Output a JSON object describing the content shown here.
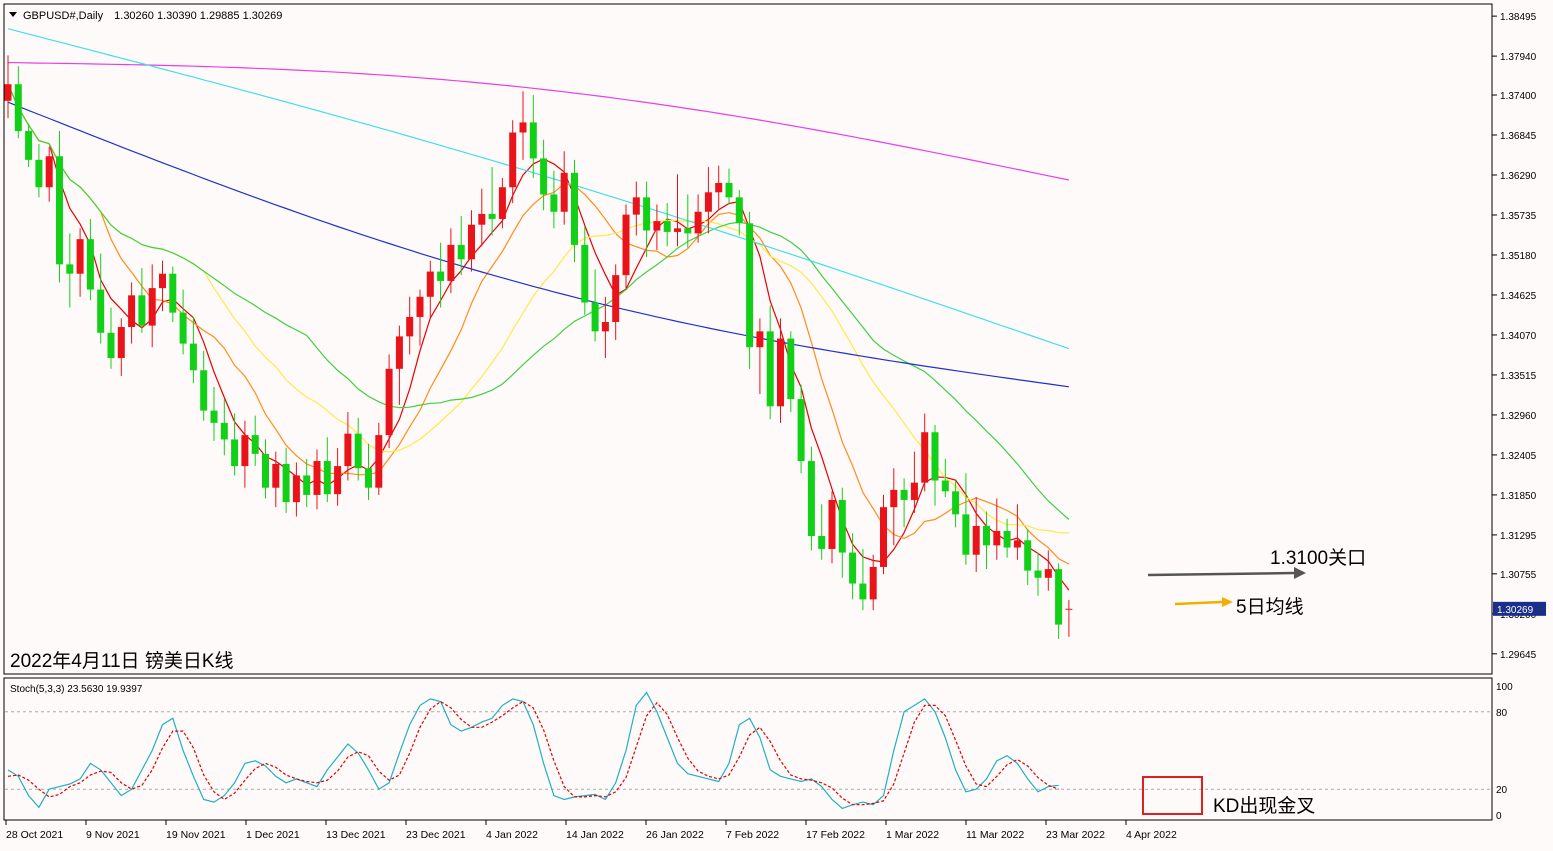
{
  "chart_data": {
    "type": "candlestick",
    "symbol_header": "GBPUSD#,Daily",
    "ohlc_header": "1.30260 1.30390 1.29885 1.30269",
    "annotation_title": "2022年4月11日 镑美日K线",
    "current_price_label": "1.30269",
    "price_axis": {
      "ticks": [
        "1.38495",
        "1.37940",
        "1.37400",
        "1.36845",
        "1.36290",
        "1.35735",
        "1.35180",
        "1.34625",
        "1.34070",
        "1.33515",
        "1.32960",
        "1.32405",
        "1.31850",
        "1.31295",
        "1.30755",
        "1.30200",
        "1.29645"
      ],
      "range": [
        1.2942,
        1.3858
      ]
    },
    "date_ticks": [
      "28 Oct 2021",
      "9 Nov 2021",
      "19 Nov 2021",
      "1 Dec 2021",
      "13 Dec 2021",
      "23 Dec 2021",
      "4 Jan 2022",
      "14 Jan 2022",
      "26 Jan 2022",
      "7 Feb 2022",
      "17 Feb 2022",
      "1 Mar 2022",
      "11 Mar 2022",
      "23 Mar 2022",
      "4 Apr 2022"
    ],
    "callouts": {
      "level_1310": "1.3100关口",
      "ma5": "5日均线",
      "kd_cross": "KD出现金叉"
    },
    "colors": {
      "bull": "#e8141a",
      "bear": "#12d018",
      "ma5": "#e60000",
      "ma10": "#ff8c1a",
      "ma20": "#ffe84a",
      "ma30": "#40d040",
      "ma60": "#2030d0",
      "ma120": "#40e0e8",
      "ma250": "#e640e6",
      "stoch_main": "#20b0c0",
      "stoch_signal": "#e00000"
    },
    "candles": [
      [
        1.3732,
        1.3795,
        1.3708,
        1.3755
      ],
      [
        1.3755,
        1.378,
        1.368,
        1.369
      ],
      [
        1.369,
        1.37,
        1.364,
        1.365
      ],
      [
        1.365,
        1.3672,
        1.3598,
        1.3612
      ],
      [
        1.3612,
        1.3668,
        1.3592,
        1.3655
      ],
      [
        1.3655,
        1.369,
        1.348,
        1.3505
      ],
      [
        1.3505,
        1.3548,
        1.3445,
        1.3492
      ],
      [
        1.3492,
        1.3555,
        1.346,
        1.354
      ],
      [
        1.354,
        1.3568,
        1.3455,
        1.347
      ],
      [
        1.347,
        1.352,
        1.3395,
        1.341
      ],
      [
        1.341,
        1.3445,
        1.336,
        1.3375
      ],
      [
        1.3375,
        1.343,
        1.335,
        1.3418
      ],
      [
        1.3418,
        1.348,
        1.3395,
        1.3462
      ],
      [
        1.3462,
        1.35,
        1.341,
        1.342
      ],
      [
        1.342,
        1.3505,
        1.339,
        1.3472
      ],
      [
        1.3472,
        1.351,
        1.344,
        1.3492
      ],
      [
        1.3492,
        1.3502,
        1.3425,
        1.3438
      ],
      [
        1.3438,
        1.347,
        1.338,
        1.3395
      ],
      [
        1.3395,
        1.3432,
        1.334,
        1.3358
      ],
      [
        1.3358,
        1.3385,
        1.3288,
        1.3302
      ],
      [
        1.3302,
        1.3335,
        1.326,
        1.3285
      ],
      [
        1.3285,
        1.3318,
        1.324,
        1.3262
      ],
      [
        1.3262,
        1.3298,
        1.3212,
        1.3225
      ],
      [
        1.3225,
        1.3288,
        1.3195,
        1.3268
      ],
      [
        1.3268,
        1.3295,
        1.3225,
        1.3242
      ],
      [
        1.3242,
        1.3262,
        1.318,
        1.3195
      ],
      [
        1.3195,
        1.3245,
        1.3168,
        1.3228
      ],
      [
        1.3228,
        1.325,
        1.316,
        1.3175
      ],
      [
        1.3175,
        1.323,
        1.3155,
        1.3212
      ],
      [
        1.3212,
        1.3235,
        1.3168,
        1.3185
      ],
      [
        1.3185,
        1.3248,
        1.3165,
        1.3232
      ],
      [
        1.3232,
        1.3265,
        1.3175,
        1.3186
      ],
      [
        1.3186,
        1.325,
        1.317,
        1.3225
      ],
      [
        1.3225,
        1.33,
        1.3205,
        1.327
      ],
      [
        1.327,
        1.3292,
        1.3205,
        1.3222
      ],
      [
        1.3222,
        1.3256,
        1.3178,
        1.3195
      ],
      [
        1.3195,
        1.3285,
        1.3185,
        1.3268
      ],
      [
        1.3268,
        1.338,
        1.325,
        1.336
      ],
      [
        1.336,
        1.342,
        1.331,
        1.3405
      ],
      [
        1.3405,
        1.346,
        1.338,
        1.3432
      ],
      [
        1.3432,
        1.347,
        1.3392,
        1.346
      ],
      [
        1.346,
        1.351,
        1.343,
        1.3495
      ],
      [
        1.3495,
        1.3535,
        1.3445,
        1.3482
      ],
      [
        1.3482,
        1.3555,
        1.3465,
        1.3532
      ],
      [
        1.3532,
        1.3572,
        1.349,
        1.3512
      ],
      [
        1.3512,
        1.358,
        1.3495,
        1.356
      ],
      [
        1.356,
        1.361,
        1.353,
        1.3575
      ],
      [
        1.3575,
        1.364,
        1.3545,
        1.3568
      ],
      [
        1.3568,
        1.3625,
        1.3555,
        1.3612
      ],
      [
        1.3612,
        1.3705,
        1.359,
        1.3688
      ],
      [
        1.3688,
        1.3745,
        1.365,
        1.3702
      ],
      [
        1.3702,
        1.374,
        1.3625,
        1.3652
      ],
      [
        1.3652,
        1.3678,
        1.358,
        1.3602
      ],
      [
        1.3602,
        1.3635,
        1.3555,
        1.3578
      ],
      [
        1.3578,
        1.3662,
        1.356,
        1.3632
      ],
      [
        1.3632,
        1.365,
        1.3508,
        1.3532
      ],
      [
        1.3532,
        1.3558,
        1.3435,
        1.3452
      ],
      [
        1.3452,
        1.3498,
        1.3398,
        1.3412
      ],
      [
        1.3412,
        1.346,
        1.3375,
        1.3425
      ],
      [
        1.3425,
        1.3505,
        1.34,
        1.349
      ],
      [
        1.349,
        1.3588,
        1.347,
        1.3574
      ],
      [
        1.3574,
        1.362,
        1.3545,
        1.3598
      ],
      [
        1.3598,
        1.362,
        1.3515,
        1.3552
      ],
      [
        1.3552,
        1.3588,
        1.3525,
        1.3565
      ],
      [
        1.3565,
        1.359,
        1.353,
        1.355
      ],
      [
        1.355,
        1.363,
        1.353,
        1.3555
      ],
      [
        1.3555,
        1.3602,
        1.3528,
        1.3548
      ],
      [
        1.3548,
        1.3602,
        1.3535,
        1.3578
      ],
      [
        1.3578,
        1.364,
        1.3548,
        1.3605
      ],
      [
        1.3605,
        1.3642,
        1.3582,
        1.3618
      ],
      [
        1.3618,
        1.3638,
        1.3588,
        1.3598
      ],
      [
        1.3598,
        1.3608,
        1.3545,
        1.3562
      ],
      [
        1.3562,
        1.3578,
        1.336,
        1.339
      ],
      [
        1.339,
        1.343,
        1.3325,
        1.3412
      ],
      [
        1.3412,
        1.3448,
        1.329,
        1.3308
      ],
      [
        1.3308,
        1.343,
        1.3285,
        1.3402
      ],
      [
        1.3402,
        1.3412,
        1.33,
        1.3318
      ],
      [
        1.3318,
        1.3338,
        1.3215,
        1.3232
      ],
      [
        1.3232,
        1.3252,
        1.3108,
        1.3128
      ],
      [
        1.3128,
        1.3172,
        1.3095,
        1.311
      ],
      [
        1.311,
        1.319,
        1.309,
        1.3178
      ],
      [
        1.3178,
        1.3195,
        1.307,
        1.3105
      ],
      [
        1.3105,
        1.3132,
        1.304,
        1.3062
      ],
      [
        1.3062,
        1.311,
        1.3025,
        1.304
      ],
      [
        1.304,
        1.3102,
        1.3025,
        1.3085
      ],
      [
        1.3085,
        1.3185,
        1.3075,
        1.3168
      ],
      [
        1.3168,
        1.3222,
        1.3115,
        1.3192
      ],
      [
        1.3192,
        1.3208,
        1.314,
        1.3178
      ],
      [
        1.3178,
        1.3245,
        1.316,
        1.3202
      ],
      [
        1.3202,
        1.3298,
        1.319,
        1.3272
      ],
      [
        1.3272,
        1.3282,
        1.317,
        1.3205
      ],
      [
        1.3205,
        1.3235,
        1.3182,
        1.319
      ],
      [
        1.319,
        1.3205,
        1.314,
        1.3158
      ],
      [
        1.3158,
        1.3215,
        1.3088,
        1.3102
      ],
      [
        1.3102,
        1.3182,
        1.3078,
        1.3142
      ],
      [
        1.3142,
        1.3162,
        1.3082,
        1.3115
      ],
      [
        1.3115,
        1.318,
        1.3095,
        1.3135
      ],
      [
        1.3135,
        1.3152,
        1.3098,
        1.3112
      ],
      [
        1.3112,
        1.3172,
        1.3095,
        1.3122
      ],
      [
        1.3122,
        1.3138,
        1.306,
        1.308
      ],
      [
        1.308,
        1.3105,
        1.3045,
        1.307
      ],
      [
        1.307,
        1.3108,
        1.3052,
        1.3082
      ],
      [
        1.3082,
        1.309,
        1.2985,
        1.3005
      ],
      [
        1.3026,
        1.3039,
        1.2988,
        1.3027
      ]
    ],
    "stochastic": {
      "label": "Stoch(5,3,3) 23.5630 19.9397",
      "main": 23.563,
      "signal": 19.9397,
      "levels": [
        20,
        80
      ],
      "ticks": [
        "100",
        "80",
        "20",
        "0"
      ],
      "main_series": [
        35,
        30,
        15,
        6,
        20,
        22,
        24,
        28,
        40,
        35,
        25,
        15,
        20,
        35,
        50,
        70,
        75,
        50,
        30,
        12,
        10,
        15,
        25,
        40,
        42,
        38,
        30,
        25,
        28,
        25,
        22,
        35,
        45,
        55,
        48,
        35,
        20,
        25,
        48,
        70,
        85,
        90,
        88,
        70,
        65,
        68,
        72,
        75,
        85,
        90,
        88,
        70,
        40,
        15,
        12,
        14,
        15,
        16,
        12,
        25,
        50,
        85,
        95,
        80,
        60,
        40,
        32,
        30,
        28,
        26,
        40,
        70,
        75,
        60,
        35,
        30,
        28,
        26,
        28,
        22,
        12,
        5,
        8,
        10,
        8,
        15,
        50,
        80,
        85,
        90,
        80,
        60,
        35,
        18,
        20,
        28,
        42,
        46,
        40,
        28,
        18,
        22,
        23
      ],
      "signal_series": [
        30,
        31,
        27,
        20,
        14,
        16,
        22,
        25,
        31,
        34,
        33,
        25,
        20,
        23,
        35,
        52,
        65,
        65,
        52,
        31,
        18,
        12,
        17,
        27,
        36,
        40,
        37,
        31,
        28,
        26,
        25,
        27,
        34,
        45,
        49,
        46,
        34,
        27,
        31,
        48,
        68,
        82,
        88,
        83,
        74,
        68,
        68,
        72,
        77,
        83,
        88,
        83,
        66,
        42,
        22,
        14,
        14,
        15,
        14,
        18,
        29,
        53,
        77,
        87,
        78,
        60,
        44,
        34,
        30,
        28,
        31,
        45,
        62,
        68,
        57,
        42,
        31,
        28,
        27,
        25,
        21,
        13,
        8,
        8,
        9,
        11,
        24,
        48,
        72,
        85,
        85,
        77,
        58,
        38,
        24,
        22,
        30,
        39,
        43,
        38,
        29,
        23,
        20
      ]
    }
  }
}
